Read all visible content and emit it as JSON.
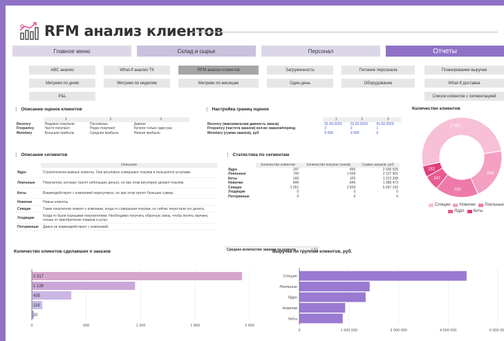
{
  "header": {
    "title": "RFM анализ клиентов"
  },
  "nav": [
    {
      "label": "Главное меню",
      "active": false
    },
    {
      "label": "Склад и сырье",
      "active": false
    },
    {
      "label": "Персонал",
      "active": false
    },
    {
      "label": "Отчеты",
      "active": true
    }
  ],
  "reports": {
    "row1": [
      "ABC анализ",
      "What-If анализ ТК",
      "RFM анализ клиентов",
      "Загруженность",
      "Питание персонала",
      "Планирование выручки"
    ],
    "row2": [
      "Метрики по дням",
      "Метрики по неделям",
      "Метрики по месяцам",
      "Один день",
      "Оборудование",
      "What-If доставка"
    ],
    "row3_left": "P&L",
    "row3_right": "Список клиентов с сегментацией"
  },
  "scores": {
    "title": "Описание оценок клиентов",
    "cols": [
      "1",
      "2",
      "3"
    ],
    "rows": [
      {
        "name": "Recency",
        "v": [
          "Недавно покупали",
          "Пассивные",
          "Давние"
        ]
      },
      {
        "name": "Frequency",
        "v": [
          "Часто покупают",
          "Редко покупают",
          "Купили только один раз"
        ]
      },
      {
        "name": "Monetary",
        "v": [
          "Большая прибыль",
          "Средняя прибыль",
          "Низкая прибыль"
        ]
      }
    ]
  },
  "bounds": {
    "title": "Настройка границ оценок",
    "cols": [
      "1",
      "2",
      "3"
    ],
    "rows": [
      {
        "name": "Recency (максимальная давность заказа)",
        "v": [
          "01.04.2023",
          "01.02.2023",
          "01.02.2023"
        ]
      },
      {
        "name": "Frequency (частота заказов) кол-во заказов/период",
        "v": [
          "3",
          "2",
          "1"
        ]
      },
      {
        "name": "Monetary (сумма заказов), руб",
        "v": [
          "5 000",
          "3 000",
          "0"
        ]
      }
    ]
  },
  "segments": {
    "title": "Описание сегментов",
    "col": "Описание",
    "rows": [
      {
        "name": "Ядро",
        "desc": "Стратегически важные клиенты. Они регулярно совершают покупки и пользуются услугами."
      },
      {
        "name": "Лояльные",
        "desc": "Покупатели, которые тратят небольшие деньги, но при этом регулярно делают покупки."
      },
      {
        "name": "Киты",
        "desc": "Взаимодействуют с компанией нерегулярно, но при этом тратят большие суммы."
      },
      {
        "name": "Новички",
        "desc": "Новые клиенты"
      },
      {
        "name": "Спящие",
        "desc": "Такие покупатели помнят о компании, когда-то совершали покупки, но сейчас перестали это делать."
      },
      {
        "name": "Уходящие",
        "desc": "Когда-то были хорошими покупателями. Необходимо получить обратную связь, чтобы понять причину отказа от приобретения товаров и услуг."
      },
      {
        "name": "Потерянные",
        "desc": "Давно не взаимодействуют с компанией."
      }
    ]
  },
  "stats": {
    "title": "Статистика по сегментам",
    "cols": [
      "Количество клиентов",
      "Количество покупок (чеков)",
      "Сумма заказов, руб."
    ],
    "rows": [
      {
        "name": "Ядро",
        "v": [
          "247",
          "856",
          "2 005 526"
        ]
      },
      {
        "name": "Лояльные",
        "v": [
          "700",
          "1 609",
          "2 127 901"
        ]
      },
      {
        "name": "Киты",
        "v": [
          "182",
          "325",
          "1 312 338"
        ]
      },
      {
        "name": "Новички",
        "v": [
          "846",
          "846",
          "1 385 473"
        ]
      },
      {
        "name": "Спящие",
        "v": [
          "2 051",
          "2 829",
          "5 057 192"
        ]
      },
      {
        "name": "Уходящие",
        "v": [
          "0",
          "0",
          "0"
        ]
      },
      {
        "name": "Потерянные",
        "v": [
          "0",
          "0",
          "0"
        ]
      }
    ],
    "avg_label": "Среднее количество заказов на клиента",
    "avg_value": "1.61"
  },
  "chart_data": [
    {
      "type": "pie",
      "title": "Количество клиентов",
      "categories": [
        "Спящие",
        "Новички",
        "Лояльные",
        "Ядро",
        "Киты"
      ],
      "values": [
        2051,
        846,
        700,
        247,
        182
      ],
      "labels": [
        "2 051",
        "846",
        "700",
        "247",
        "182"
      ],
      "colors": [
        "#f7c0d6",
        "#f4a0c2",
        "#ee7aaa",
        "#e85a92",
        "#e13f7c"
      ],
      "legend": "bottom"
    },
    {
      "type": "bar",
      "title": "Количество клиентов сделавших n заказов",
      "orientation": "horizontal",
      "values": [
        2317,
        1138,
        435,
        116,
        20
      ],
      "labels": [
        "2 317",
        "1 138",
        "435",
        "116",
        "20"
      ],
      "colors": [
        "#d6a6cc",
        "#cba7d9",
        "#c9b6e3",
        "#c6bde6",
        "#a99be0"
      ],
      "xlim": [
        0,
        2400
      ],
      "xticks": [
        "0",
        "600",
        "1 200",
        "1 800",
        "2 400"
      ],
      "grid": true
    },
    {
      "type": "bar",
      "title": "Выручка по группам клиентов, руб.",
      "orientation": "horizontal",
      "categories": [
        "Спящие",
        "Лояльные",
        "Ядро",
        "Новички",
        "Киты"
      ],
      "values": [
        5057192,
        2127901,
        2005526,
        1385473,
        1312338
      ],
      "color": "#9a7ad2",
      "xlim": [
        0,
        6000000
      ],
      "xticks": [
        "0",
        "1 500 000",
        "3 000 000",
        "4 500 000",
        "6 000 000"
      ],
      "grid": true
    }
  ]
}
